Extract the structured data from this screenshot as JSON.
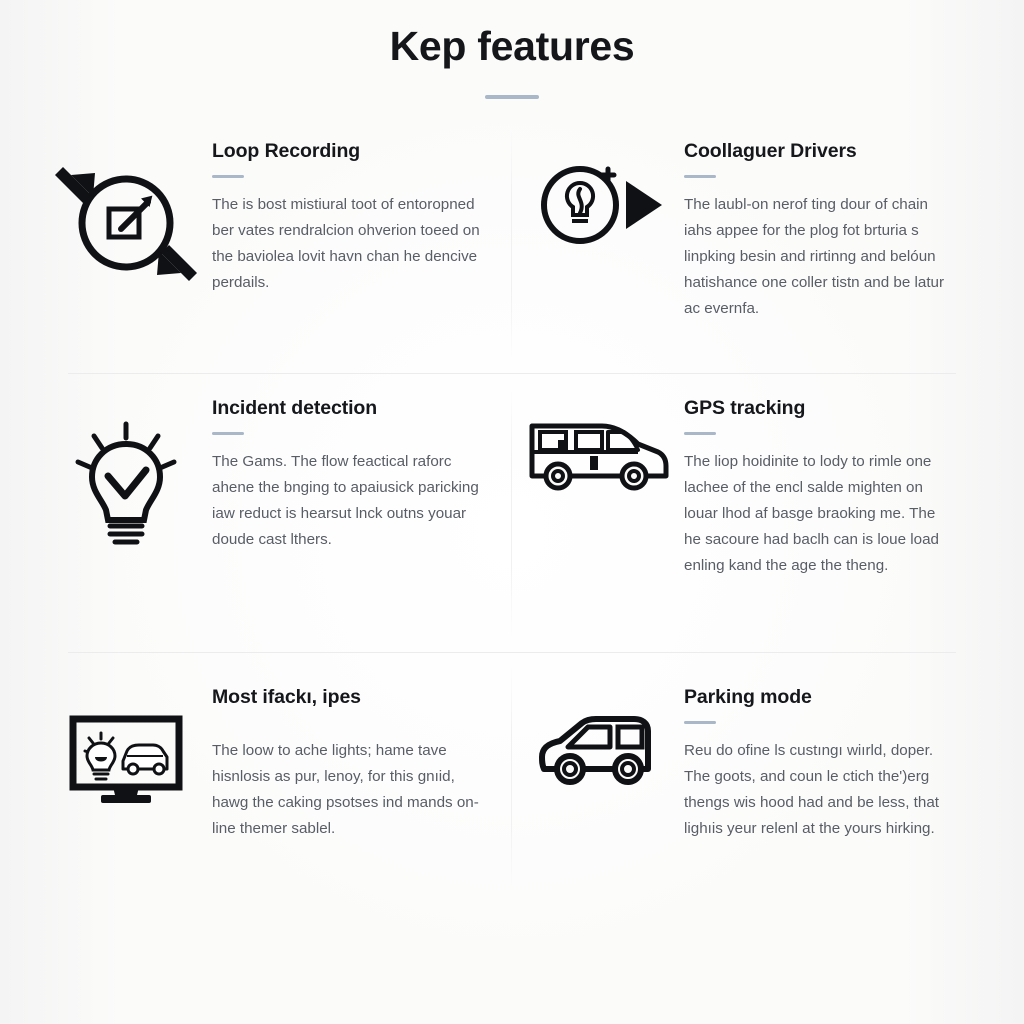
{
  "header": {
    "title": "Kep features",
    "accent_color": "#a9b7c9"
  },
  "theme": {
    "background": "#fbfbfa",
    "title_color": "#14161a",
    "body_color": "#585d66",
    "icon_color": "#101114",
    "divider_color": "#ececec"
  },
  "features": [
    {
      "title": "Loop Recording",
      "body": "The is bost mistiural toot of entoropned ber vates rendralcion ohverion toeed on the baviolea lovit havn chan he dencive perdails.",
      "icon": "circle-edit-arrows-icon",
      "has_rule": true
    },
    {
      "title": "Coollaguer Drivers",
      "body": "The laubl-on nerof ting dour of chain iahs appee for the plog fot brturia s linpking besin and rirtinng and belóun hatishance one coller tistn and be latur ac evernfa.",
      "icon": "circle-bulb-plus-play-icon",
      "has_rule": true
    },
    {
      "title": "Incident detection",
      "body": "The Gams. The flow feactical raforc ahene the bnging to apaiusick paricking iaw reduct is hearsut lnck outns youar doude cast lthers.",
      "icon": "lightbulb-check-icon",
      "has_rule": true
    },
    {
      "title": "GPS tracking",
      "body": "The liop hoidinite to lody to rimle one lachee of the encl salde mighten on louar lhod af basge braoking me. The he sacoure had baclh can is loue load enling kand the age the theng.",
      "icon": "van-icon",
      "has_rule": true
    },
    {
      "title": "Most ifackı, ipes",
      "body": "The loow to ache lights; hame tave hisnlosis as pur, lenoy, for this gnıid, hawg the caking psotses ind mands on-line themer sablel.",
      "icon": "monitor-bulb-car-icon",
      "has_rule": false
    },
    {
      "title": "Parking mode",
      "body": "Reu do ofine ls custıngı wiırld, doper. The goots, and coun le ctich the')erg thengs wis hood had and be less, that lighıis yeur relenl at the yours hirking.",
      "icon": "suv-icon",
      "has_rule": true
    }
  ]
}
